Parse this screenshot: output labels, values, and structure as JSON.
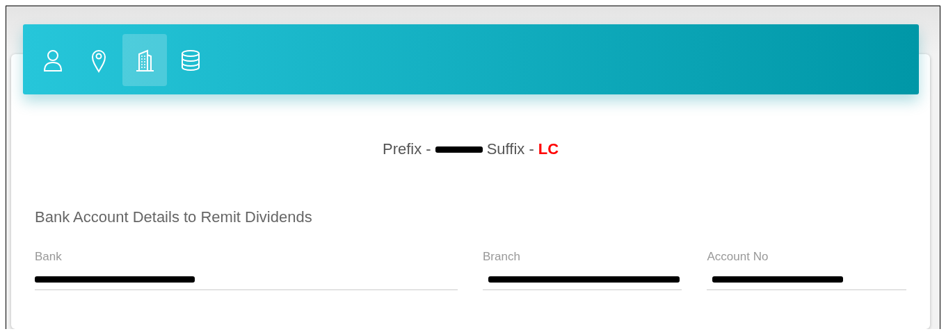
{
  "tabs": [
    {
      "kind": "person",
      "selected": false
    },
    {
      "kind": "location",
      "selected": false
    },
    {
      "kind": "building",
      "selected": true
    },
    {
      "kind": "database",
      "selected": false
    }
  ],
  "code_line": {
    "prefix_label": "Prefix -",
    "prefix_redacted": true,
    "suffix_label": "Suffix -",
    "suffix_value": "LC"
  },
  "section_title": "Bank Account Details to Remit Dividends",
  "fields": [
    {
      "label": "Bank",
      "redacted": true
    },
    {
      "label": "Branch",
      "redacted": true
    },
    {
      "label": "Account No",
      "redacted": true
    }
  ]
}
